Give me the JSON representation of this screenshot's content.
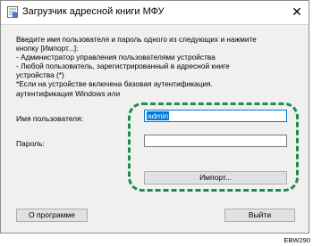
{
  "window": {
    "title": "Загрузчик адресной книги МФУ",
    "close_glyph": "✕"
  },
  "instructions": [
    "Введите имя пользователя и пароль одного из следующих и нажмите",
    "кнопку [Импорт...]:",
    "- Администратор управления пользователями устройства",
    "- Любой пользователь, зарегистрированный в адресной книге",
    "устройства (*)",
    "*Если на устройстве включена базовая аутентификация.",
    "аутентификация Windows или"
  ],
  "username": {
    "label": "Имя пользователя:",
    "value": "admin"
  },
  "password": {
    "label": "Пароль:",
    "value": ""
  },
  "buttons": {
    "import": "Импорт...",
    "about": "О программе",
    "exit": "Выйти"
  },
  "figure_code": "EBW290",
  "colors": {
    "highlight": "#1e8e4e",
    "selection": "#0078d7",
    "dialog_background": "#f0f0f0"
  },
  "icons": {
    "app": "address-book-icon",
    "close": "close-icon"
  }
}
